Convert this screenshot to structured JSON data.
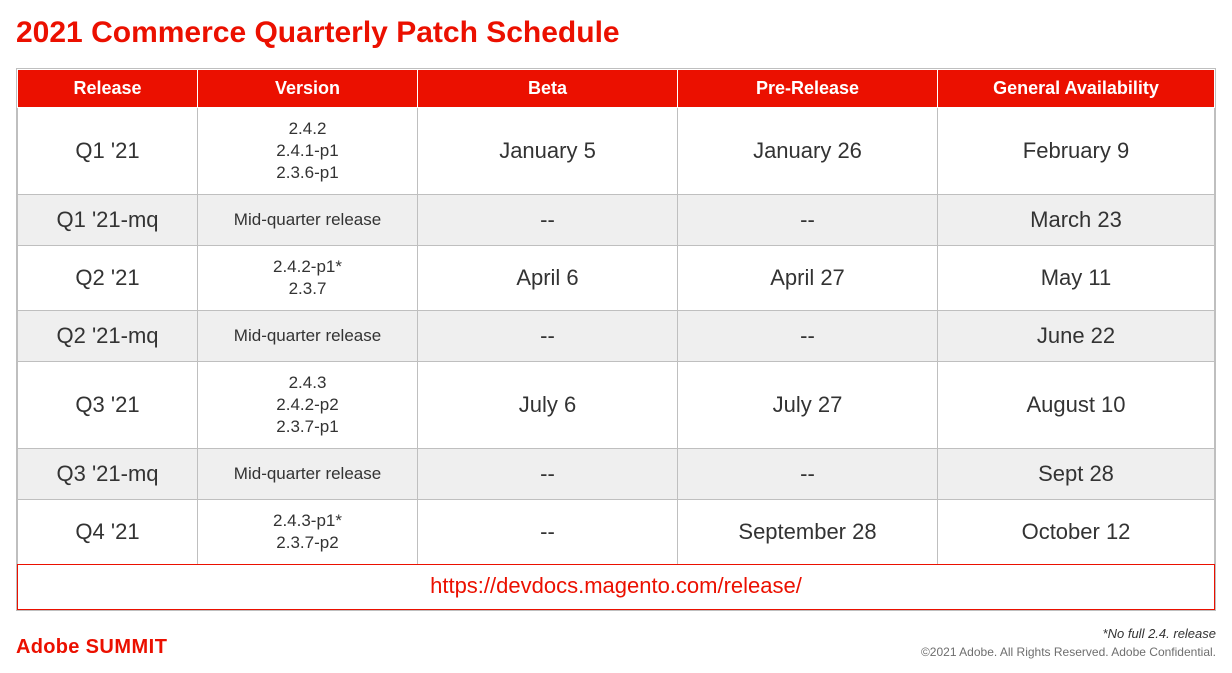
{
  "title": "2021 Commerce Quarterly Patch Schedule",
  "columns": [
    "Release",
    "Version",
    "Beta",
    "Pre-Release",
    "General Availability"
  ],
  "rows": [
    {
      "release": "Q1 '21",
      "versions": [
        "2.4.2",
        "2.4.1-p1",
        "2.3.6-p1"
      ],
      "mq": false,
      "beta": "January 5",
      "pre": "January 26",
      "ga": "February 9"
    },
    {
      "release": "Q1 '21-mq",
      "versions": [
        "Mid-quarter release"
      ],
      "mq": true,
      "beta": "--",
      "pre": "--",
      "ga": "March 23"
    },
    {
      "release": "Q2 '21",
      "versions": [
        "2.4.2-p1*",
        "2.3.7"
      ],
      "mq": false,
      "beta": "April 6",
      "pre": "April 27",
      "ga": "May 11"
    },
    {
      "release": "Q2 '21-mq",
      "versions": [
        "Mid-quarter release"
      ],
      "mq": true,
      "beta": "--",
      "pre": "--",
      "ga": "June 22"
    },
    {
      "release": "Q3 '21",
      "versions": [
        "2.4.3",
        "2.4.2-p2",
        "2.3.7-p1"
      ],
      "mq": false,
      "beta": "July 6",
      "pre": "July 27",
      "ga": "August 10"
    },
    {
      "release": "Q3 '21-mq",
      "versions": [
        "Mid-quarter release"
      ],
      "mq": true,
      "beta": "--",
      "pre": "--",
      "ga": "Sept 28"
    },
    {
      "release": "Q4 '21",
      "versions": [
        "2.4.3-p1*",
        "2.3.7-p2"
      ],
      "mq": false,
      "beta": "--",
      "pre": "September 28",
      "ga": "October 12"
    }
  ],
  "link": "https://devdocs.magento.com/release/",
  "footnote": "*No full 2.4. release",
  "copyright": "©2021 Adobe. All Rights Reserved. Adobe Confidential.",
  "brand": {
    "name": "Adobe",
    "event": "SUMMIT"
  }
}
